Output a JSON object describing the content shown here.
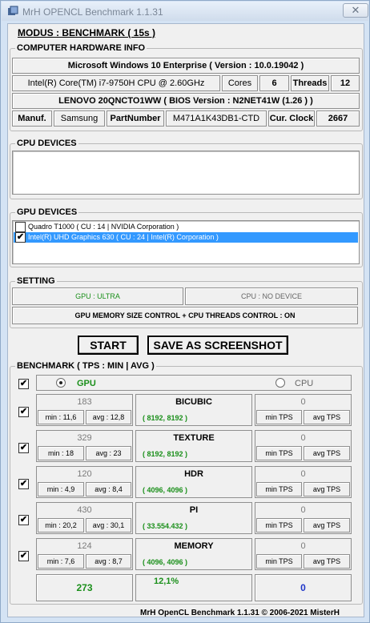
{
  "window": {
    "title": "MrH OPENCL Benchmark 1.1.31",
    "close": "✕"
  },
  "mode": {
    "label": "MODUS : BENCHMARK ( 15s )"
  },
  "hardware": {
    "title": "COMPUTER HARDWARE INFO",
    "os": "Microsoft Windows 10 Enterprise ( Version : 10.0.19042 )",
    "cpu": "Intel(R) Core(TM) i7-9750H CPU @ 2.60GHz",
    "cores_label": "Cores",
    "cores": "6",
    "threads_label": "Threads",
    "threads": "12",
    "bios": "LENOVO 20QNCTO1WW ( BIOS Version : N2NET41W (1.26 ) )",
    "manuf_label": "Manuf.",
    "manuf": "Samsung",
    "part_label": "PartNumber",
    "part": "M471A1K43DB1-CTD",
    "clock_label": "Cur. Clock",
    "clock": "2667"
  },
  "cpu_devices": {
    "title": "CPU DEVICES"
  },
  "gpu_devices": {
    "title": "GPU DEVICES",
    "items": [
      {
        "label": "Quadro T1000 ( CU : 14 | NVIDIA Corporation )",
        "checked": false
      },
      {
        "label": "Intel(R) UHD Graphics 630 ( CU : 24 | Intel(R) Corporation )",
        "checked": true
      }
    ]
  },
  "setting": {
    "title": "SETTING",
    "gpu_mode": "GPU : ULTRA",
    "cpu_mode": "CPU : NO DEVICE",
    "control": "GPU MEMORY SIZE CONTROL + CPU THREADS CONTROL : ON"
  },
  "buttons": {
    "start": "START",
    "screenshot": "SAVE AS SCREENSHOT"
  },
  "benchmark": {
    "title": "BENCHMARK ( TPS : MIN | AVG )",
    "gpu_label": "GPU",
    "cpu_label": "CPU",
    "tests": [
      {
        "name": "BICUBIC",
        "size": "( 8192, 8192 )",
        "gpu_tps": "183",
        "gpu_min": "min : 11,6",
        "gpu_avg": "avg : 12,8",
        "cpu_tps": "0",
        "cpu_min": "min TPS",
        "cpu_avg": "avg TPS"
      },
      {
        "name": "TEXTURE",
        "size": "( 8192, 8192 )",
        "gpu_tps": "329",
        "gpu_min": "min : 18",
        "gpu_avg": "avg : 23",
        "cpu_tps": "0",
        "cpu_min": "min TPS",
        "cpu_avg": "avg TPS"
      },
      {
        "name": "HDR",
        "size": "( 4096, 4096 )",
        "gpu_tps": "120",
        "gpu_min": "min : 4,9",
        "gpu_avg": "avg : 8,4",
        "cpu_tps": "0",
        "cpu_min": "min TPS",
        "cpu_avg": "avg TPS"
      },
      {
        "name": "PI",
        "size": "( 33.554.432 )",
        "gpu_tps": "430",
        "gpu_min": "min : 20,2",
        "gpu_avg": "avg : 30,1",
        "cpu_tps": "0",
        "cpu_min": "min TPS",
        "cpu_avg": "avg TPS"
      },
      {
        "name": "MEMORY",
        "size": "( 4096, 4096 )",
        "gpu_tps": "124",
        "gpu_min": "min : 7,6",
        "gpu_avg": "avg : 8,7",
        "cpu_tps": "0",
        "cpu_min": "min TPS",
        "cpu_avg": "avg TPS"
      }
    ],
    "gpu_score": "273",
    "percent": "12,1%",
    "cpu_score": "0"
  },
  "footer": {
    "text": "MrH OpenCL Benchmark 1.1.31  ©  2006-2021 MisterH"
  },
  "colors": {
    "green": "#1a8f1a",
    "blue": "#1f36c9",
    "selection": "#3399ff"
  }
}
